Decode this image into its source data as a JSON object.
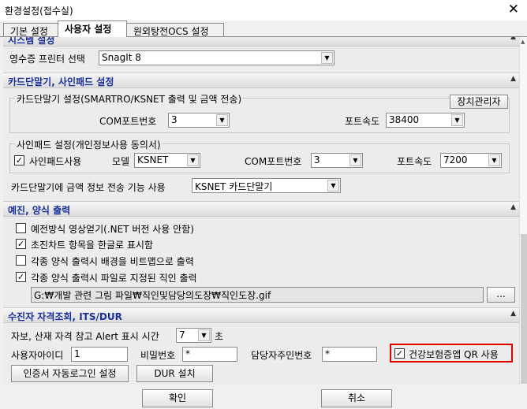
{
  "window": {
    "title": "환경설정(접수실)",
    "close_glyph": "✕"
  },
  "tabs": [
    {
      "label": "기본 설정"
    },
    {
      "label": "사용자 설정"
    },
    {
      "label": "원외탕전OCS 설정"
    }
  ],
  "system": {
    "header": "시스템 설정",
    "receipt_printer_label": "영수증 프린터 선택",
    "receipt_printer_value": "SnagIt 8"
  },
  "card": {
    "header": "카드단말기, 사인패드 설정",
    "terminal_group_title": "카드단말기 설정(SMARTRO/KSNET 출력 및 금액 전송)",
    "device_manager_label": "장치관리자",
    "com_port_label": "COM포트번호",
    "com_port_value": "3",
    "baud_label": "포트속도",
    "baud_value": "38400",
    "signpad_group_title": "사인패드 설정(개인정보사용 동의서)",
    "signpad_use_label": "사인패드사용",
    "signpad_use_checked": "☑",
    "model_label": "모델",
    "model_value": "KSNET",
    "signpad_com_label": "COM포트번호",
    "signpad_com_value": "3",
    "signpad_baud_label": "포트속도",
    "signpad_baud_value": "7200",
    "amount_transfer_label": "카드단말기에 금액 정보 전송 기능 사용",
    "amount_transfer_value": "KSNET 카드단말기"
  },
  "print": {
    "header": "예진, 양식 출력",
    "options": [
      {
        "label": "예전방식  영상얻기(.NET 버전 사용 안함)",
        "checked": ""
      },
      {
        "label": "초진차트 항목을 한글로 표시함",
        "checked": "✓"
      },
      {
        "label": "각종 양식 출력시 배경을 비트맵으로 출력",
        "checked": ""
      },
      {
        "label": "각종 양식 출력시 파일로 지정된 직인 출력",
        "checked": "✓"
      }
    ],
    "seal_path": "G:₩개발 관련 그림 파일₩직인및담당의도장₩직인도장.gif",
    "browse_label": "..."
  },
  "qual": {
    "header": "수진자 자격조회, ITS/DUR",
    "alert_time_label": "자보, 산재 자격 참고 Alert 표시 시간",
    "alert_time_value": "7",
    "alert_time_unit": "초",
    "user_id_label": "사용자아이디",
    "user_id_value": "1",
    "password_label": "비밀번호",
    "password_value": "*",
    "manager_rrn_label": "담당자주민번호",
    "manager_rrn_value": "*",
    "qr_label": "건강보험증앱 QR 사용",
    "qr_checked": "✓",
    "cert_login_label": "인증서 자동로그인 설정",
    "dur_install_label": "DUR 설치"
  },
  "collapse_glyph": "▲",
  "dropdown_glyph": "▼",
  "footer": {
    "ok_label": "확인",
    "cancel_label": "취소"
  },
  "colors": {
    "section_title": "#1c2fa0",
    "highlight": "#e00000"
  }
}
